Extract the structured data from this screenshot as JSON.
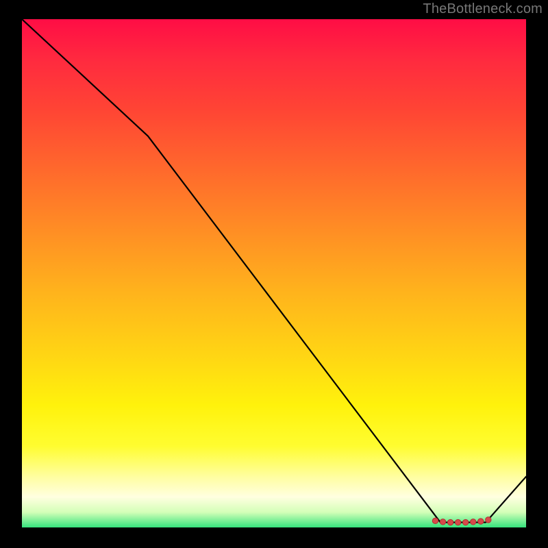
{
  "attribution": "TheBottleneck.com",
  "colors": {
    "line": "#000000",
    "point_fill": "#d64a4a",
    "point_stroke": "#b23030",
    "gradient_top": "#ff0d45",
    "gradient_bottom": "#35e37c"
  },
  "chart_data": {
    "type": "line",
    "title": "",
    "xlabel": "",
    "ylabel": "",
    "xlim": [
      0,
      100
    ],
    "ylim": [
      0,
      100
    ],
    "x": [
      0,
      25,
      83,
      92,
      100
    ],
    "y": [
      100,
      77,
      1,
      1,
      10
    ],
    "marker_points_x": [
      82,
      83.5,
      85,
      86.5,
      88,
      89.5,
      91,
      92.5
    ],
    "marker_points_y": [
      1.3,
      1.1,
      1.0,
      1.0,
      1.0,
      1.1,
      1.2,
      1.5
    ],
    "annotations": []
  }
}
